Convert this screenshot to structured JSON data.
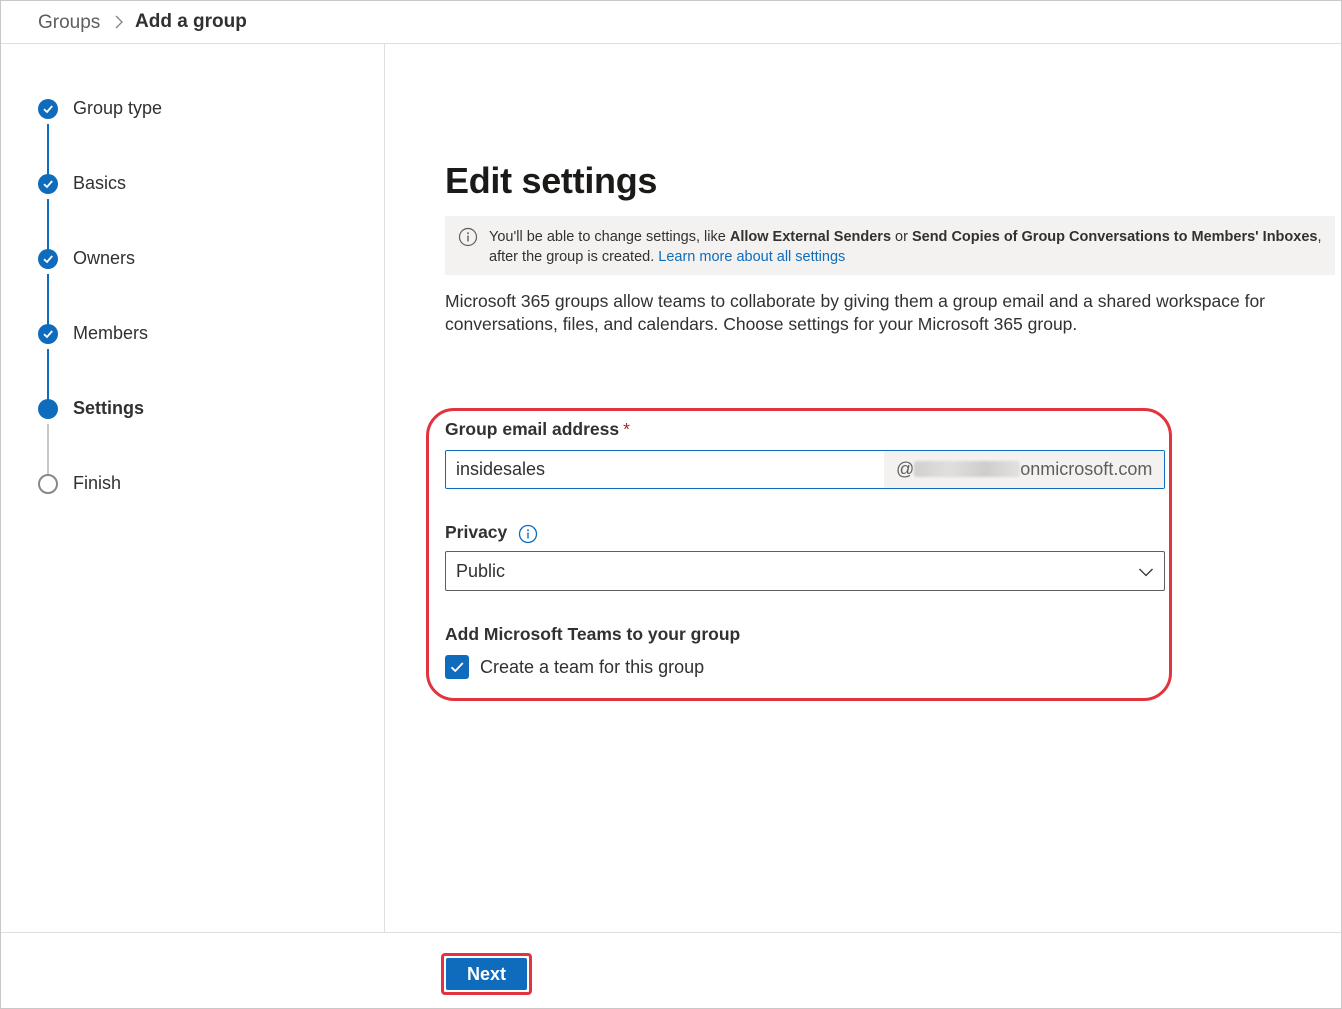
{
  "breadcrumb": {
    "root": "Groups",
    "current": "Add a group"
  },
  "steps": [
    {
      "label": "Group type",
      "state": "done"
    },
    {
      "label": "Basics",
      "state": "done"
    },
    {
      "label": "Owners",
      "state": "done"
    },
    {
      "label": "Members",
      "state": "done"
    },
    {
      "label": "Settings",
      "state": "current"
    },
    {
      "label": "Finish",
      "state": "todo"
    }
  ],
  "main": {
    "title": "Edit settings",
    "info": {
      "prefix": "You'll be able to change settings, like ",
      "setting_1": "Allow External Senders",
      "or": " or ",
      "setting_2": "Send Copies of Group Conversations to Members' Inboxes",
      "suffix": ", after the group is created. ",
      "link": "Learn more about all settings"
    },
    "description": "Microsoft 365 groups allow teams to collaborate by giving them a group email and a shared workspace for conversations, files, and calendars. Choose settings for your Microsoft 365 group."
  },
  "form": {
    "email_label": "Group email address",
    "required_marker": "*",
    "email_value": "insidesales",
    "email_at": "@",
    "email_domain": "onmicrosoft.com",
    "privacy_label": "Privacy",
    "privacy_value": "Public",
    "teams_label": "Add Microsoft Teams to your group",
    "teams_checkbox_label": "Create a team for this group",
    "teams_checked": true
  },
  "footer": {
    "next_label": "Next"
  },
  "colors": {
    "accent": "#0f6cbd",
    "highlight": "#e3333f"
  }
}
